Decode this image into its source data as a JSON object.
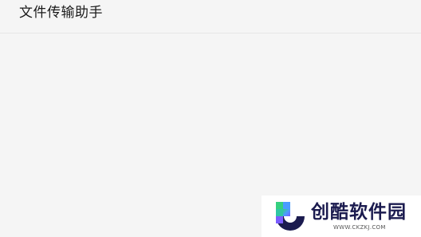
{
  "header": {
    "title": "文件传输助手"
  },
  "watermark": {
    "brand": "创酷软件园",
    "url": "WWW.CKZKJ.COM",
    "logo_icon": "c-logo-icon",
    "colors": {
      "navy": "#1b1b4f",
      "green": "#35d07f",
      "purple": "#7a5cff",
      "blue": "#4a9cff"
    }
  }
}
